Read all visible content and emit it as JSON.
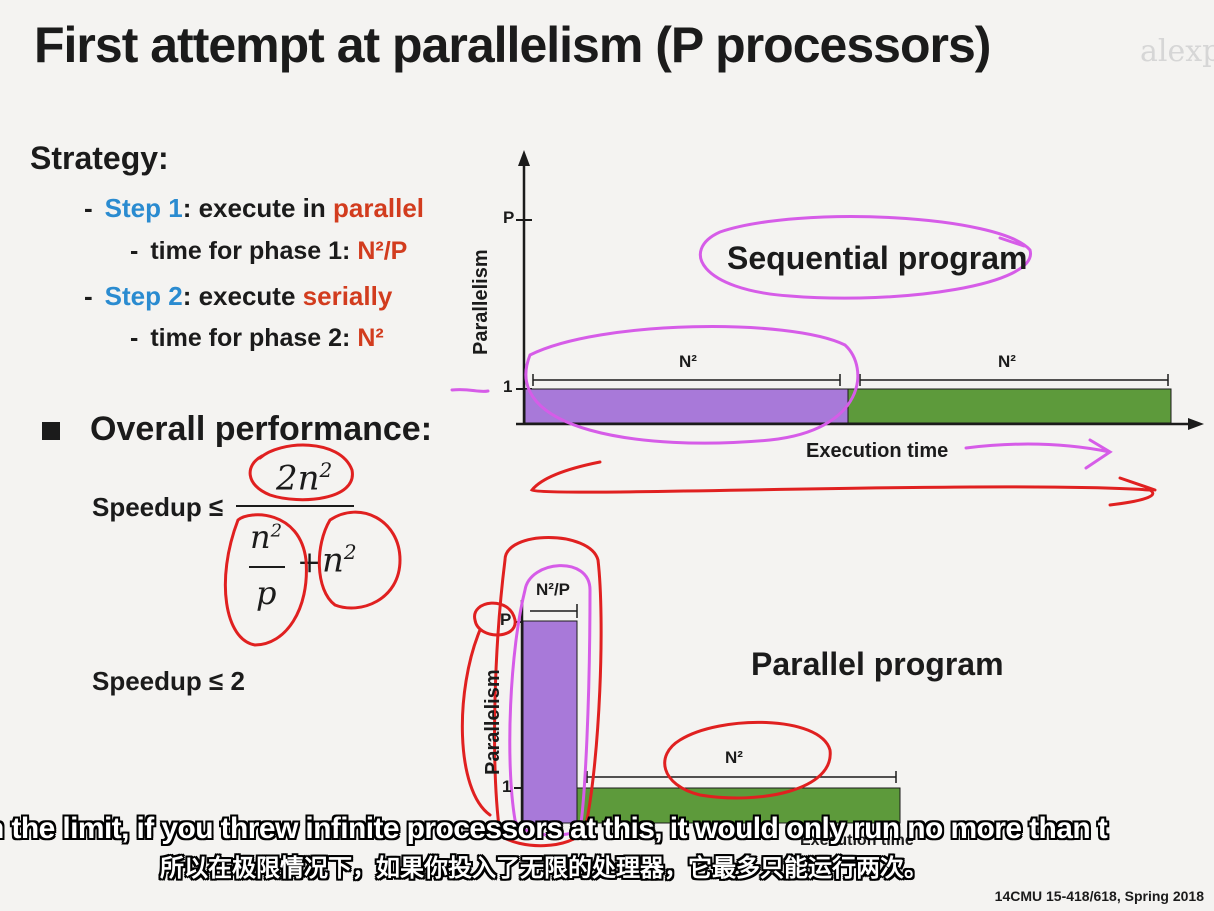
{
  "slide": {
    "title": "First attempt at parallelism (P processors)",
    "watermark": "alexp"
  },
  "strategy": {
    "heading": "Strategy:",
    "step1_label": "Step 1",
    "step1_text": ": execute in ",
    "step1_highlight": "parallel",
    "phase1_text": "time for phase 1: ",
    "phase1_value": "N²/P",
    "step2_label": "Step 2",
    "step2_text": ": execute ",
    "step2_highlight": "serially",
    "phase2_text": "time for phase 2: ",
    "phase2_value": "N²"
  },
  "overall": {
    "heading": "Overall performance:",
    "speedup_label": "Speedup ≤",
    "numerator": "2n",
    "num_exp": "2",
    "denom_n": "n",
    "denom_n_exp": "2",
    "denom_p": "p",
    "plus": "+",
    "denom_n2": "n",
    "denom_n2_exp": "2",
    "result": "Speedup ≤ 2"
  },
  "sequential_chart": {
    "title": "Sequential program",
    "ylabel": "Parallelism",
    "xlabel": "Execution time",
    "tick_p": "P",
    "tick_1": "1",
    "seg1_label": "N²",
    "seg2_label": "N²"
  },
  "parallel_chart": {
    "title": "Parallel program",
    "ylabel": "Parallelism",
    "xlabel": "Execution time",
    "tick_p": "P",
    "tick_1": "1",
    "seg1_label": "N²/P",
    "seg2_label": "N²"
  },
  "subtitles": {
    "english": "n the limit, if you threw infinite processors at this, it would only run no more than t",
    "chinese": "所以在极限情况下，如果你投入了无限的处理器，它最多只能运行两次。"
  },
  "footer": "14CMU 15-418/618, Spring 2018",
  "colors": {
    "purple_bar": "#a879d9",
    "green_bar": "#5d9a3b",
    "annotation_red": "#e02020",
    "annotation_magenta": "#d65ce8",
    "step_blue": "#2a8bd0",
    "highlight_red": "#d23c1e"
  }
}
